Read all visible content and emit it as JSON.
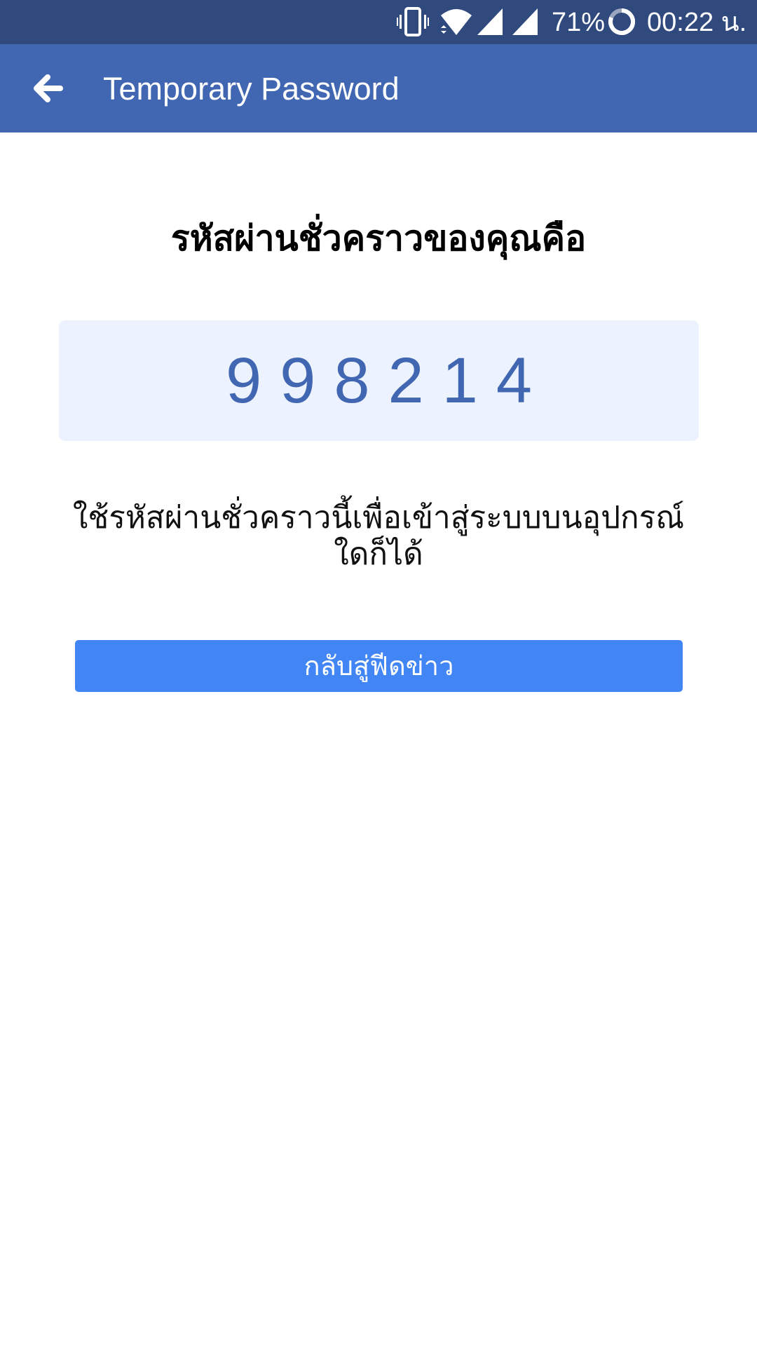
{
  "status_bar": {
    "battery_percent": "71%",
    "time": "00:22 น.",
    "icons": [
      "vibrate-icon",
      "wifi-icon",
      "signal-icon",
      "signal-icon",
      "battery-icon"
    ]
  },
  "app_bar": {
    "title": "Temporary Password",
    "back_icon": "back-arrow-icon"
  },
  "main": {
    "heading": "รหัสผ่านชั่วคราวของคุณคือ",
    "code": "998214",
    "description": "ใช้รหัสผ่านชั่วคราวนี้เพื่อเข้าสู่ระบบบนอุปกรณ์ใดก็ได้",
    "button_label": "กลับสู่ฟีดข่าว"
  },
  "colors": {
    "status_bar": "#314a7e",
    "app_bar": "#4267b2",
    "code_box": "#ecf3ff",
    "code_text": "#4267b2",
    "button": "#4285f4"
  }
}
